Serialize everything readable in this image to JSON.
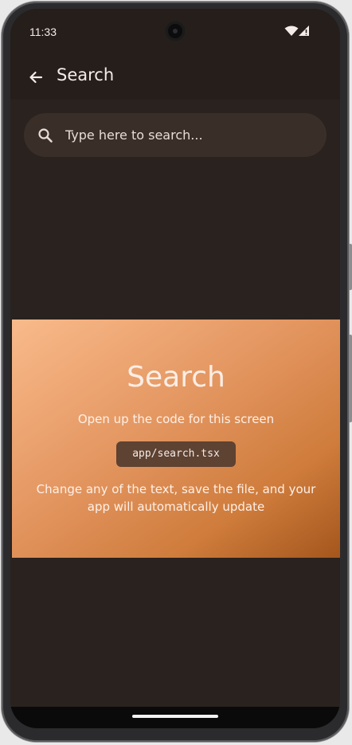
{
  "status_bar": {
    "time": "11:33",
    "icons": [
      "wifi-icon",
      "cellular-icon"
    ]
  },
  "app_bar": {
    "back_icon": "arrow-left-icon",
    "title": "Search"
  },
  "search": {
    "icon": "search-icon",
    "placeholder": "Type here to search...",
    "value": ""
  },
  "hero": {
    "title": "Search",
    "subtitle": "Open up the code for this screen",
    "code": "app/search.tsx",
    "description": "Change any of the text, save the file, and your app will automatically update"
  },
  "colors": {
    "background": "#2a221e",
    "app_bar": "#251e1a",
    "search_field": "#3a2e28",
    "gradient_start": "#f9ba8b",
    "gradient_end": "#a4561c",
    "code_chip": "#5e4232",
    "text": "#f3ece8"
  }
}
